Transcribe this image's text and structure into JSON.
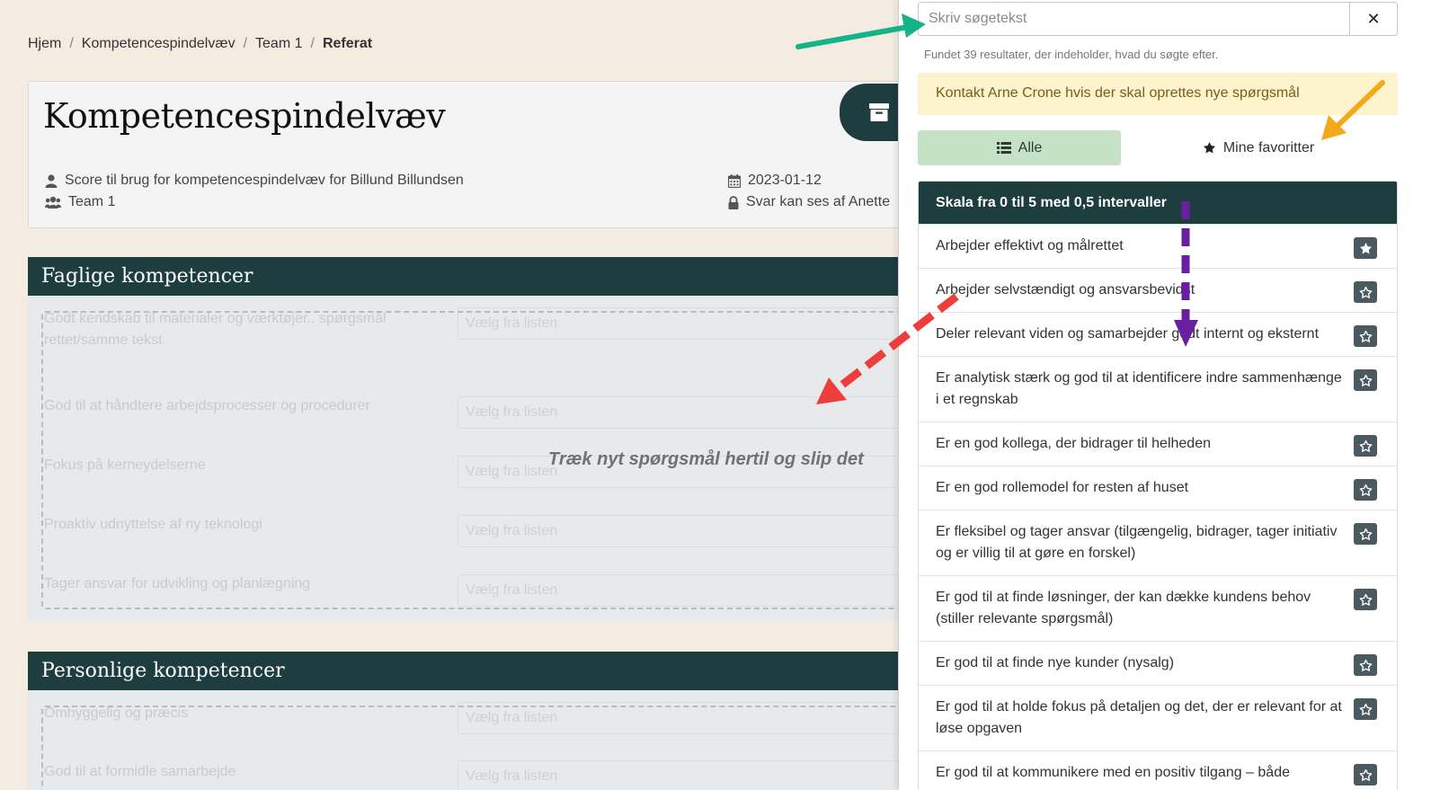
{
  "breadcrumb": {
    "items": [
      "Hjem",
      "Kompetencespindelvæv",
      "Team 1"
    ],
    "current": "Referat",
    "separator": "/"
  },
  "header": {
    "title": "Kompetencespindelvæv",
    "score_text": "Score til brug for kompetencespindelvæv for Billund Billundsen",
    "team": "Team 1",
    "date": "2023-01-12",
    "visibility": "Svar kan ses af Anette"
  },
  "sections": [
    {
      "title": "Faglige kompetencer",
      "questions": [
        "Godt kendskab til materialer og værktøjer.. spørgsmål rettet/samme tekst",
        "God til at håndtere arbejdsprocesser og procedurer",
        "Fokus på kerneydelserne",
        "Proaktiv udnyttelse af ny teknologi",
        "Tager ansvar for udvikling og planlægning"
      ],
      "select_placeholder": "Vælg fra listen"
    },
    {
      "title": "Personlige kompetencer",
      "questions": [
        "Omhyggelig og præcis",
        "God til at formidle samarbejde"
      ],
      "select_placeholder": "Vælg fra listen"
    }
  ],
  "drop_hint": "Træk nyt spørgsmål hertil og slip det",
  "panel": {
    "search_placeholder": "Skriv søgetekst",
    "clear_label": "✕",
    "found_text": "Fundet 39 resultater, der indeholder, hvad du søgte efter.",
    "alert_text": "Kontakt Arne Crone hvis der skal oprettes nye spørgsmål",
    "tab_all": "Alle",
    "tab_favorites": "Mine favoritter",
    "list_header": "Skala fra 0 til 5 med 0,5 intervaller",
    "items": [
      {
        "text": "Arbejder effektivt og målrettet",
        "favorite": true
      },
      {
        "text": "Arbejder selvstændigt og ansvarsbevidst",
        "favorite": false
      },
      {
        "text": "Deler relevant viden og samarbejder godt internt og eksternt",
        "favorite": false
      },
      {
        "text": "Er analytisk stærk og god til at identificere indre sammenhænge i et regnskab",
        "favorite": false
      },
      {
        "text": "Er en god kollega, der bidrager til helheden",
        "favorite": false
      },
      {
        "text": "Er en god rollemodel for resten af huset",
        "favorite": false
      },
      {
        "text": "Er fleksibel og tager ansvar (tilgængelig, bidrager, tager initiativ og er villig til at gøre en forskel)",
        "favorite": false
      },
      {
        "text": "Er god til at finde løsninger, der kan dække kundens behov (stiller relevante spørgsmål)",
        "favorite": false
      },
      {
        "text": "Er god til at finde nye kunder (nysalg)",
        "favorite": false
      },
      {
        "text": "Er god til at holde fokus på detaljen og det, der er relevant for at løse opgaven",
        "favorite": false
      },
      {
        "text": "Er god til at kommunikere med en positiv tilgang – både",
        "favorite": false
      }
    ]
  },
  "colors": {
    "dark_teal": "#1e3d3f",
    "alert_bg": "#fdf3cd",
    "tab_active": "#c6e2c6",
    "arrow_green": "#14b38a",
    "arrow_orange": "#f4a91a",
    "arrow_purple": "#6a1fa3",
    "arrow_red": "#ee3d3d"
  },
  "icons": {
    "archive": "archive-icon",
    "user": "user-icon",
    "users": "users-icon",
    "calendar": "calendar-icon",
    "lock": "lock-icon",
    "list": "list-icon",
    "star": "star-icon"
  }
}
